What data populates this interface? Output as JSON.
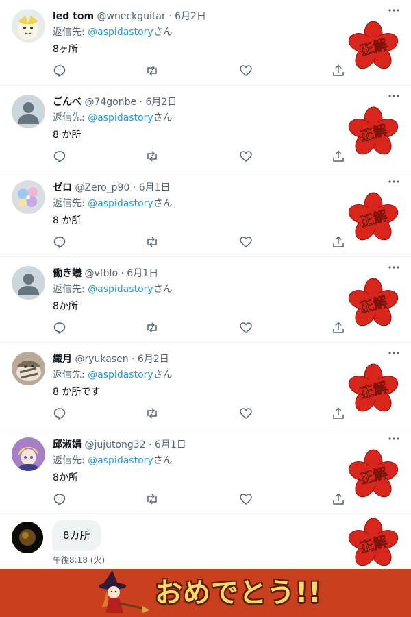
{
  "colors": {
    "name": "#0f1419",
    "meta": "#536471",
    "link": "#1d9bf0",
    "divider": "#eff3f4",
    "stamp": "#d8261c",
    "stamp_text": "#ffd86b",
    "banner": "#c8401d"
  },
  "reply_prefix": "返信先:",
  "reply_suffix": "さん",
  "stamp_label": "正解",
  "tweets": [
    {
      "name": "led tom",
      "meta": "@wneckguitar · 6月2日",
      "reply_to": "@aspidastory",
      "text": "8ヶ所",
      "avatar_icon": "jirachi-avatar"
    },
    {
      "name": "ごんべ",
      "meta": "@74gonbe · 6月2日",
      "reply_to": "@aspidastory",
      "text": " 8 か所",
      "avatar_icon": "default-avatar"
    },
    {
      "name": "ゼロ",
      "meta": "@Zero_p90 · 6月1日",
      "reply_to": "@aspidastory",
      "text": " 8 か所",
      "avatar_icon": "flower-avatar"
    },
    {
      "name": "働き蟻",
      "meta": "@vfblo · 6月1日",
      "reply_to": "@aspidastory",
      "text": "8か所",
      "avatar_icon": "default-avatar"
    },
    {
      "name": "織月",
      "meta": "@ryukasen · 6月2日",
      "reply_to": "@aspidastory",
      "text": " 8 か所です",
      "avatar_icon": "cat-avatar"
    },
    {
      "name": "邱淑娟",
      "meta": "@jujutong32 · 6月1日",
      "reply_to": "@aspidastory",
      "text": "8か所",
      "avatar_icon": "anime-avatar"
    }
  ],
  "dm": {
    "text": "8カ所",
    "time": "午後8:18 (火)",
    "avatar_icon": "dark-sphere-avatar"
  },
  "banner": {
    "text": "おめでとう!!",
    "icon": "witch-character-icon"
  }
}
